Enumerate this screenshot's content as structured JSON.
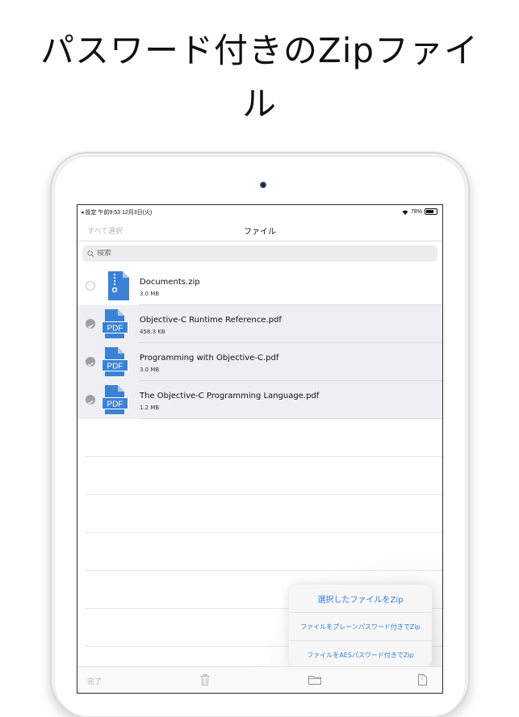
{
  "headline": {
    "line1": "パスワード付きのZipファイ",
    "line2": "ル"
  },
  "statusbar": {
    "left": "◂ 設定  午前9:53  12月3日(火)",
    "battery": "78%"
  },
  "navbar": {
    "select_all": "すべて選択",
    "title": "ファイル"
  },
  "search": {
    "placeholder": "検索"
  },
  "files": [
    {
      "name": "Documents.zip",
      "size": "3.0 MB",
      "type": "zip",
      "selected": false
    },
    {
      "name": "Objective-C Runtime Reference.pdf",
      "size": "458.3 KB",
      "type": "pdf",
      "selected": true
    },
    {
      "name": "Programming with Objective-C.pdf",
      "size": "3.0 MB",
      "type": "pdf",
      "selected": true
    },
    {
      "name": "The Objective-C Programming Language.pdf",
      "size": "1.2 MB",
      "type": "pdf",
      "selected": true
    }
  ],
  "icons": {
    "pdf_label": "PDF",
    "file_color": "#3b82d6",
    "check_color": "#9e9ea3",
    "accent": "#2f7be0"
  },
  "popover": {
    "zip_selected": "選択したファイルをZip",
    "zip_plain_password": "ファイルをプレーンパスワード付きでZip",
    "zip_aes_password": "ファイルをAESパスワード付きでZip"
  },
  "toolbar": {
    "done": "完了",
    "trash_icon": "trash-icon",
    "folder_icon": "folder-icon",
    "archive_icon": "archive-icon"
  }
}
